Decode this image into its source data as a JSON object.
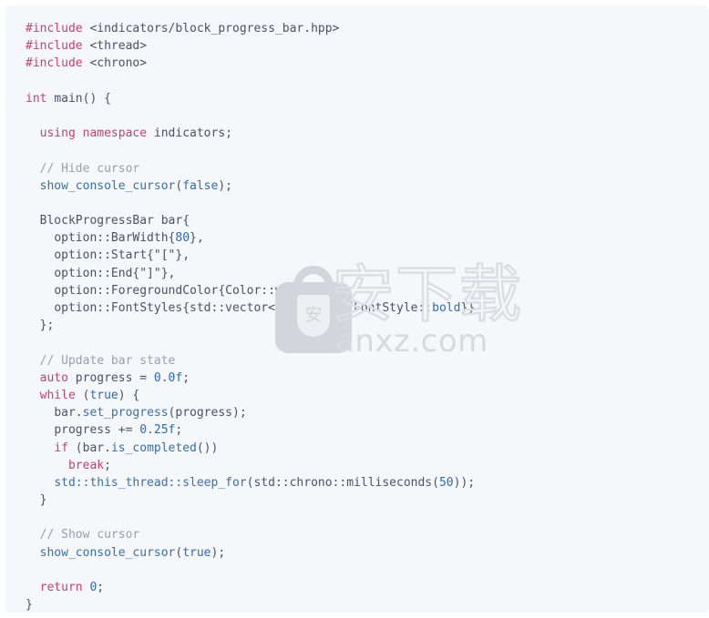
{
  "card": {
    "background_color": "#f6f7fb",
    "language": "cpp"
  },
  "code": {
    "lines": [
      "#include <indicators/block_progress_bar.hpp>",
      "#include <thread>",
      "#include <chrono>",
      "",
      "int main() {",
      "",
      "  using namespace indicators;",
      "",
      "  // Hide cursor",
      "  show_console_cursor(false);",
      "",
      "  BlockProgressBar bar{",
      "    option::BarWidth{80},",
      "    option::Start{\"[\"},",
      "    option::End{\"]\"},",
      "    option::ForegroundColor{Color::white},",
      "    option::FontStyles{std::vector<FontStyle>{FontStyle::bold}}",
      "  };",
      "",
      "  // Update bar state",
      "  auto progress = 0.0f;",
      "  while (true) {",
      "    bar.set_progress(progress);",
      "    progress += 0.25f;",
      "    if (bar.is_completed())",
      "      break;",
      "    std::this_thread::sleep_for(std::chrono::milliseconds(50));",
      "  }",
      "",
      "  // Show cursor",
      "  show_console_cursor(true);",
      "",
      "  return 0;",
      "}"
    ],
    "colors": {
      "keyword": "#c0456a",
      "comment": "#9aa0a8",
      "function": "#3b6fa8",
      "number": "#2f6bb5",
      "boolean": "#2f6bb5",
      "plain": "#4a5360"
    }
  },
  "watermark": {
    "chinese_text": "安下载",
    "domain_text": "anxz.com",
    "badge_glyph": "安",
    "color": "#d7d9de"
  }
}
